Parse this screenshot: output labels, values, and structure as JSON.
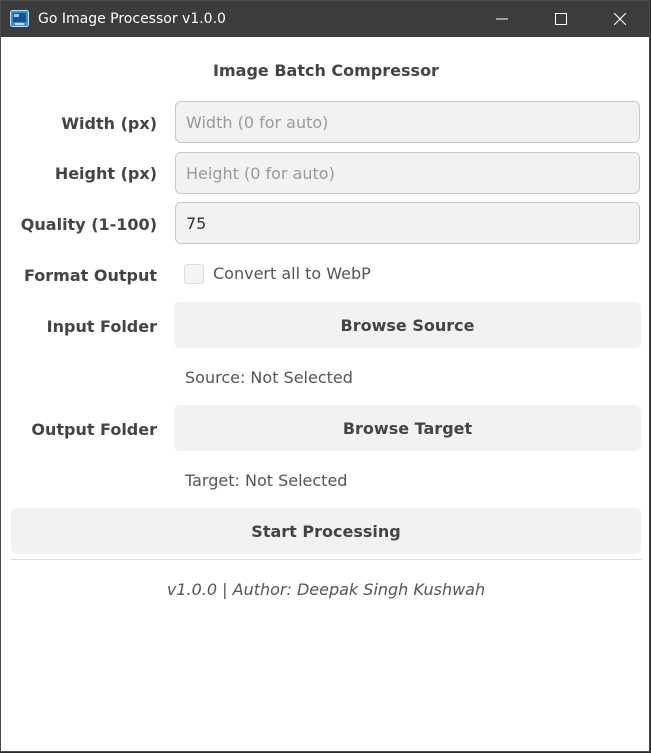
{
  "window": {
    "title": "Go Image Processor v1.0.0",
    "controls": {
      "minimize": "—",
      "maximize": "☐",
      "close": "✕"
    }
  },
  "app": {
    "heading": "Image Batch Compressor",
    "width": {
      "label": "Width (px)",
      "placeholder": "Width (0 for auto)",
      "value": ""
    },
    "height": {
      "label": "Height (px)",
      "placeholder": "Height (0 for auto)",
      "value": ""
    },
    "quality": {
      "label": "Quality (1-100)",
      "value": "75"
    },
    "format": {
      "label": "Format Output",
      "checkbox_label": "Convert all to WebP",
      "checked": false
    },
    "input": {
      "label": "Input Folder",
      "button": "Browse Source",
      "status": "Source: Not Selected"
    },
    "output": {
      "label": "Output Folder",
      "button": "Browse Target",
      "status": "Target: Not Selected"
    },
    "start_button": "Start Processing",
    "footer": "v1.0.0 | Author: Deepak Singh Kushwah"
  },
  "colors": {
    "titlebar": "#3c3c3c",
    "button_bg": "#f2f2f2",
    "field_bg": "#f2f2f2",
    "text": "#444444"
  }
}
